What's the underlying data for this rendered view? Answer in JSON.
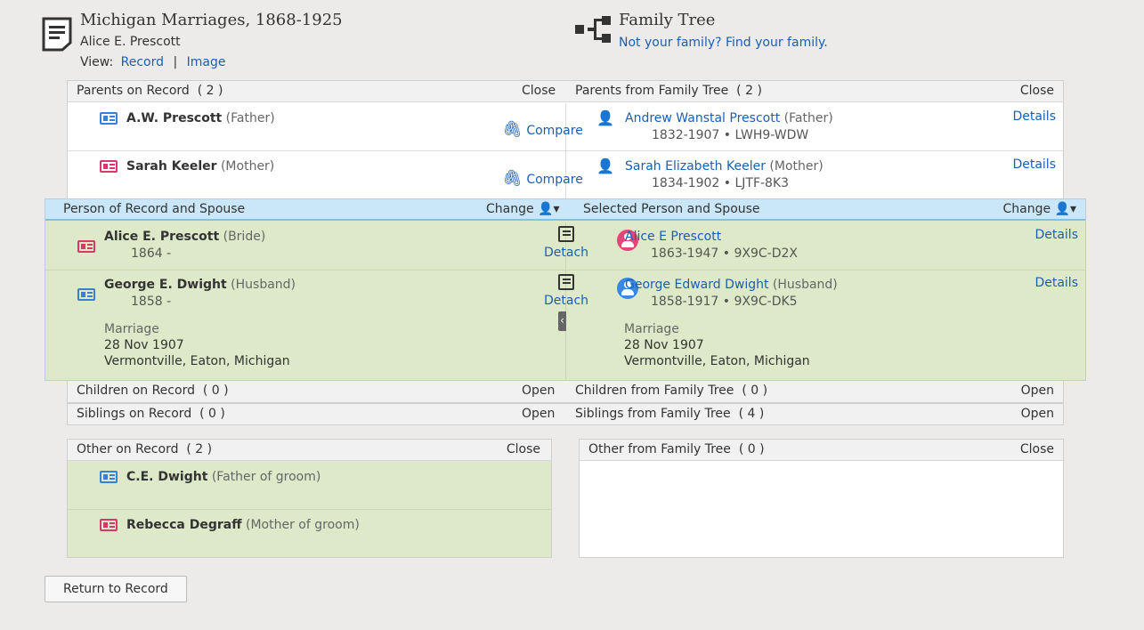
{
  "header": {
    "record_title": "Michigan Marriages, 1868-1925",
    "record_person": "Alice E. Prescott",
    "view_label": "View:",
    "view_record": "Record",
    "view_sep": "|",
    "view_image": "Image",
    "tree_title": "Family Tree",
    "tree_link": "Not your family? Find your family."
  },
  "parents": {
    "record_head": "Parents on Record",
    "record_count": "( 2 )",
    "record_action": "Close",
    "tree_head": "Parents from Family Tree",
    "tree_count": "( 2 )",
    "tree_action": "Close",
    "rows": [
      {
        "rec_name": "A.W. Prescott",
        "rec_role": "(Father)",
        "compare": "Compare",
        "tree_name": "Andrew Wanstal Prescott",
        "tree_role": "(Father)",
        "tree_dates": "1832-1907 • LWH9-WDW",
        "details": "Details"
      },
      {
        "rec_name": "Sarah Keeler",
        "rec_role": "(Mother)",
        "compare": "Compare",
        "tree_name": "Sarah Elizabeth Keeler",
        "tree_role": "(Mother)",
        "tree_dates": "1834-1902 • LJTF-8K3",
        "details": "Details"
      }
    ]
  },
  "couple": {
    "record_head": "Person of Record and Spouse",
    "record_change": "Change",
    "tree_head": "Selected Person and Spouse",
    "tree_change": "Change",
    "rows": [
      {
        "rec_name": "Alice E. Prescott",
        "rec_role": "(Bride)",
        "rec_dates": "1864 -",
        "detach": "Detach",
        "tree_name": "Alice E Prescott",
        "tree_role": "",
        "tree_dates": "1863-1947 • 9X9C-D2X",
        "details": "Details"
      },
      {
        "rec_name": "George E. Dwight",
        "rec_role": "(Husband)",
        "rec_dates": "1858 -",
        "detach": "Detach",
        "tree_name": "George Edward Dwight",
        "tree_role": "(Husband)",
        "tree_dates": "1858-1917 • 9X9C-DK5",
        "details": "Details"
      }
    ],
    "marriage_label": "Marriage",
    "rec_marriage_date": "28 Nov 1907",
    "rec_marriage_place": "Vermontville, Eaton, Michigan",
    "tree_marriage_date": "28 Nov 1907",
    "tree_marriage_place": "Vermontville, Eaton, Michigan",
    "collapse_glyph": "‹"
  },
  "children": {
    "record_head": "Children on Record",
    "record_count": "( 0 )",
    "record_action": "Open",
    "tree_head": "Children from Family Tree",
    "tree_count": "( 0 )",
    "tree_action": "Open"
  },
  "siblings": {
    "record_head": "Siblings on Record",
    "record_count": "( 0 )",
    "record_action": "Open",
    "tree_head": "Siblings from Family Tree",
    "tree_count": "( 4 )",
    "tree_action": "Open"
  },
  "other_record": {
    "head": "Other on Record",
    "count": "( 2 )",
    "action": "Close",
    "rows": [
      {
        "name": "C.E. Dwight",
        "role": "(Father of groom)"
      },
      {
        "name": "Rebecca Degraff",
        "role": "(Mother of groom)"
      }
    ]
  },
  "other_tree": {
    "head": "Other from Family Tree",
    "count": "( 0 )",
    "action": "Close"
  },
  "footer": {
    "return_button": "Return to Record"
  },
  "colors": {
    "link": "#1a5fb4",
    "green_bg": "#dde9c8",
    "blue_head": "#c9e7f8",
    "male": "#3a7fd6",
    "female": "#d63a6a"
  }
}
